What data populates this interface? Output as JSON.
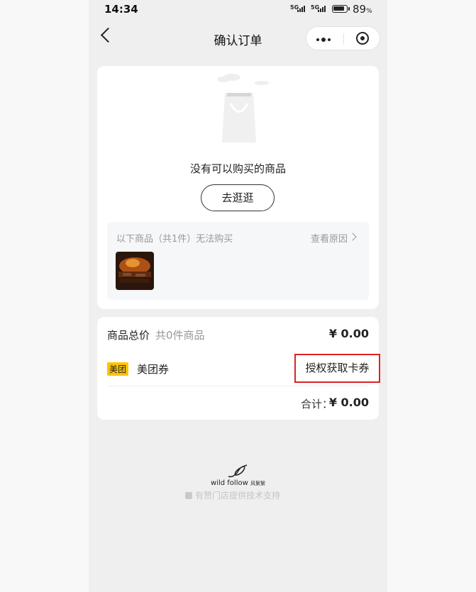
{
  "status_bar": {
    "time": "14:34",
    "signal_1": "5G",
    "signal_2": "5G",
    "battery_level": 0.89,
    "battery_pct": "89",
    "battery_unit": "%"
  },
  "nav": {
    "title": "确认订单"
  },
  "empty_state": {
    "message": "没有可以购买的商品",
    "browse_button": "去逛逛"
  },
  "unavailable": {
    "label": "以下商品（共1件）无法购买",
    "reason_link": "查看原因"
  },
  "summary": {
    "total_label": "商品总价",
    "item_count": "共0件商品",
    "total_amount": "¥ 0.00",
    "coupon_tag": "美团",
    "coupon_label": "美团券",
    "authorize_button": "授权获取卡券",
    "sum_label": "合计：",
    "sum_amount": "¥ 0.00"
  },
  "footer": {
    "brand": "wild follow",
    "brand_cn": "风絮絮",
    "powered_by": "有赞门店提供技术支持"
  },
  "colors": {
    "highlight_border": "#dd2222",
    "coupon_tag": "#ffc300"
  }
}
